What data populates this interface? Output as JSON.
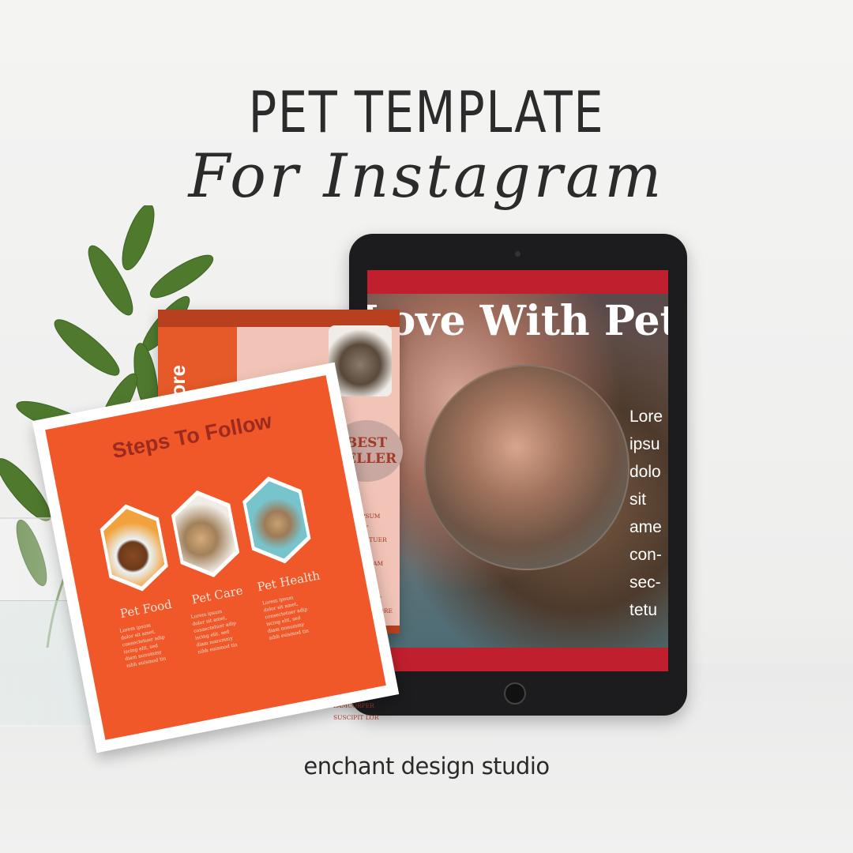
{
  "heading": {
    "title": "PET TEMPLATE",
    "subtitle": "For Instagram"
  },
  "footer": {
    "studio": "enchant design studio"
  },
  "tablet_screen": {
    "headline": "Love With Pet",
    "body": "Lore\nipsu\ndolo\nsit\name\ncon-\nsec-\ntetu"
  },
  "card_back": {
    "vertical_text": "more",
    "oval_text": "BEST SELLER",
    "lorem": "LOREM IPSUM DOLOR SIT\nCONSECTETUER ADIPISC\nELIT, SED DIAM NONUMM\nEUISMOD TINCIDUNT UT\nLAOREET DOLORE MAGNA\nALIQUAM ERAT VOLUTPAT\nWISI AD MINIM VENIAM\nNOSTRUD EXERCI TATION\nLAMCORPER SUSCIPIT LOR"
  },
  "card_front": {
    "title": "Steps To Follow",
    "items": [
      {
        "label": "Pet Food",
        "desc": "Lorem ipsum\ndolor sit amet,\nconsectetuer adip\niscing elit, sed\ndiam nonummy\nnibh euismod tin"
      },
      {
        "label": "Pet Care",
        "desc": "Lorem ipsum\ndolor sit amet,\nconsectetuer adip\niscing elit, sed\ndiam nonummy\nnibh euismod tin"
      },
      {
        "label": "Pet Health",
        "desc": "Lorem ipsum\ndolor sit amet,\nconsectetuer adip\niscing elit, sed\ndiam nonummy\nnibh euismod tin"
      }
    ]
  },
  "colors": {
    "orange": "#f0582a",
    "red": "#c0202e",
    "pink": "#f2c4b8",
    "dark_red_text": "#9c2a1e"
  }
}
